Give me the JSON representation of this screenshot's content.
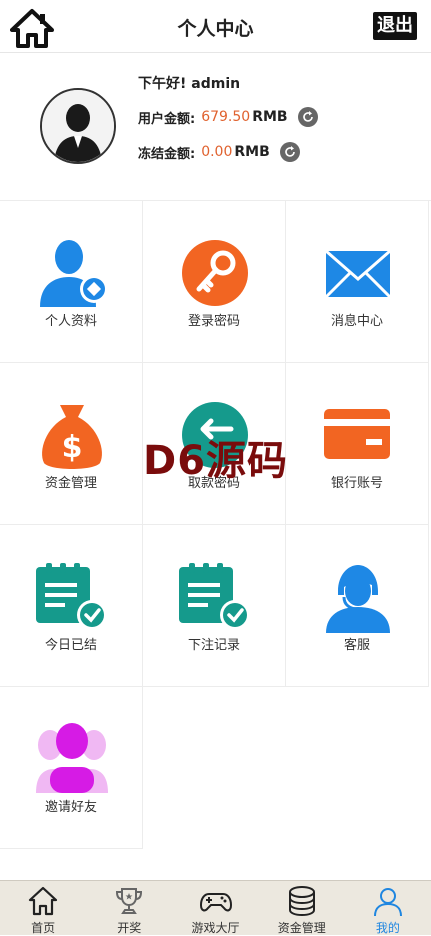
{
  "header": {
    "title": "个人中心",
    "logout_label": "退出"
  },
  "profile": {
    "greeting": "下午好! admin",
    "balance_label": "用户金额:",
    "balance_value": "679.50",
    "balance_currency": "RMB",
    "frozen_label": "冻结金额:",
    "frozen_value": "0.00",
    "frozen_currency": "RMB"
  },
  "menu": [
    {
      "label": "个人资料",
      "icon": "profile-user-icon"
    },
    {
      "label": "登录密码",
      "icon": "key-icon"
    },
    {
      "label": "消息中心",
      "icon": "envelope-icon"
    },
    {
      "label": "资金管理",
      "icon": "money-bag-icon"
    },
    {
      "label": "取款密码",
      "icon": "withdraw-arrow-icon"
    },
    {
      "label": "银行账号",
      "icon": "bank-card-icon"
    },
    {
      "label": "今日已结",
      "icon": "clipboard-check-icon"
    },
    {
      "label": "下注记录",
      "icon": "clipboard-check-icon"
    },
    {
      "label": "客服",
      "icon": "customer-service-icon"
    },
    {
      "label": "邀请好友",
      "icon": "invite-friends-icon"
    }
  ],
  "watermark": "D6源码",
  "tabs": [
    {
      "label": "首页",
      "icon": "home-icon"
    },
    {
      "label": "开奖",
      "icon": "trophy-icon"
    },
    {
      "label": "游戏大厅",
      "icon": "gamepad-icon"
    },
    {
      "label": "资金管理",
      "icon": "coins-stack-icon"
    },
    {
      "label": "我的",
      "icon": "user-icon",
      "active": true
    }
  ],
  "colors": {
    "accent": "#1f86e0",
    "amount": "#e0622f",
    "blue": "#1e88e5",
    "orange": "#f26522",
    "teal": "#159a8c",
    "magenta": "#d61be5"
  }
}
